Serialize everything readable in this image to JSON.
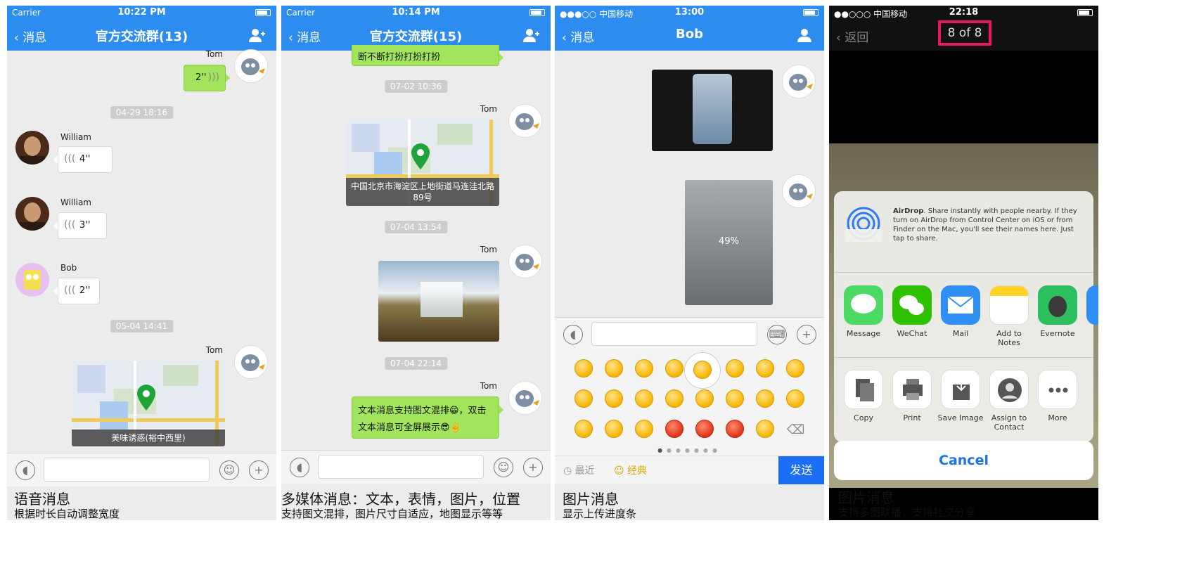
{
  "panel1": {
    "status": {
      "carrier": "Carrier",
      "time": "10:22 PM"
    },
    "nav": {
      "back": "消息",
      "title": "官方交流群(13)"
    },
    "messages": {
      "tom_name": "Tom",
      "tom_voice": "2''",
      "time1": "04-29 18:16",
      "william1_name": "William",
      "william1_voice": "4''",
      "william2_name": "William",
      "william2_voice": "3''",
      "bob_name": "Bob",
      "bob_voice": "2''",
      "time2": "05-04 14:41",
      "tom2_name": "Tom",
      "map_address": "美味诱惑(裕中西里)"
    },
    "caption": "语音消息",
    "subcaption": "根据时长自动调整宽度"
  },
  "panel2": {
    "status": {
      "carrier": "Carrier",
      "time": "10:14 PM"
    },
    "nav": {
      "back": "消息",
      "title": "官方交流群(15)"
    },
    "messages": {
      "top_text": "断不断打扮打扮打扮",
      "time1": "07-02 10:36",
      "tom1_name": "Tom",
      "map_address": "中国北京市海淀区上地街道马连洼北路89号",
      "time2": "07-04 13:54",
      "tom2_name": "Tom",
      "time3": "07-04 22:14",
      "tom3_name": "Tom",
      "text_line1": "文本消息支持图文混排😁，双击",
      "text_line2": "文本消息可全屏展示😎✌️"
    },
    "caption": "多媒体消息：文本，表情，图片，位置",
    "subcaption": "支持图文混排，图片尺寸自适应，地图显示等等"
  },
  "panel3": {
    "status": {
      "carrier": "●●●○○ 中国移动",
      "time": "13:00"
    },
    "nav": {
      "back": "消息",
      "title": "Bob"
    },
    "upload_progress": "49%",
    "emoji_tabs": {
      "recent": "最近",
      "classic": "经典",
      "send": "发送"
    },
    "caption": "图片消息",
    "subcaption": "显示上传进度条"
  },
  "panel4": {
    "status": {
      "carrier": "●●○○○ 中国移动",
      "time": "22:18"
    },
    "nav": {
      "back": "返回",
      "counter": "8 of 8"
    },
    "airdrop": {
      "title": "AirDrop",
      "text": ". Share instantly with people nearby. If they turn on AirDrop from Control Center on iOS or from Finder on the Mac, you'll see their names here. Just tap to share."
    },
    "share_apps": [
      {
        "label": "Message",
        "icon": "message-icon",
        "color": "#4cd964"
      },
      {
        "label": "WeChat",
        "icon": "wechat-icon",
        "color": "#2dc100"
      },
      {
        "label": "Mail",
        "icon": "mail-icon",
        "color": "#2f8ff5"
      },
      {
        "label": "Add to Notes",
        "icon": "notes-icon",
        "color": "#ffd426"
      },
      {
        "label": "Evernote",
        "icon": "evernote-icon",
        "color": "#2dbe60"
      }
    ],
    "actions": [
      {
        "label": "Copy",
        "icon": "copy-icon"
      },
      {
        "label": "Print",
        "icon": "print-icon"
      },
      {
        "label": "Save Image",
        "icon": "save-image-icon"
      },
      {
        "label": "Assign to Contact",
        "icon": "assign-contact-icon"
      },
      {
        "label": "More",
        "icon": "more-icon"
      }
    ],
    "cancel": "Cancel",
    "caption": "图片消息",
    "subcaption": "支持多图联播，支持社交分享"
  },
  "colors": {
    "nav_blue": "#2d8cf0",
    "bubble_green": "#a2e55d",
    "highlight_pink": "#e8175d"
  }
}
